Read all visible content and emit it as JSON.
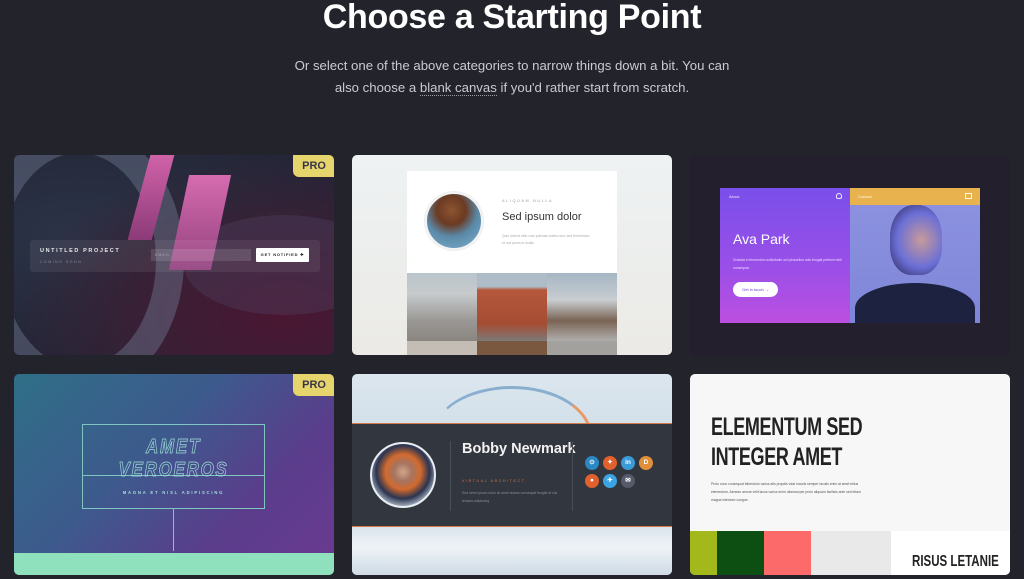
{
  "header": {
    "title": "Choose a Starting Point",
    "subtitle_before": "Or select one of the above categories to narrow things down a bit. You can also choose a ",
    "subtitle_link": "blank canvas",
    "subtitle_after": " if you'd rather start from scratch."
  },
  "colors": {
    "background": "#22232b",
    "pro_badge": "#e6d46c"
  },
  "templates": [
    {
      "badge": "PRO",
      "project_title": "UNTITLED PROJECT",
      "project_subtitle": "COMING SOON",
      "email_placeholder": "EMAIL",
      "button_label": "GET NOTIFIED ✚"
    },
    {
      "eyebrow": "ALIQUAM NULLA",
      "heading": "Sed ipsum dolor",
      "body": "Quis viverra nibh cras pulvinar mattis nunc sed fermentum et orci purus in mollis."
    },
    {
      "nav_left": "About",
      "nav_right": "Contact",
      "name": "Ava Park",
      "description": "Gravida in fermentum sollicitudin orci phasellus odio feugiat pretium nibh consequat.",
      "button_label": "Get in touch →"
    },
    {
      "badge": "PRO",
      "heading": "AMET VEROEROS",
      "subheading": "MAGNA ET NISL ADIPISCING"
    },
    {
      "name": "Bobby Newmark",
      "role": "VIRTUAL ARCHITECT",
      "bio": "Sed lorem ipsum dolor sit amet nullam consequat feugiat et nisi tempus adipiscing",
      "socials": [
        {
          "name": "github",
          "glyph": "⊙",
          "color": "#2c88c2"
        },
        {
          "name": "gitlab",
          "glyph": "✦",
          "color": "#e0612d"
        },
        {
          "name": "linkedin",
          "glyph": "in",
          "color": "#3a9bd8"
        },
        {
          "name": "dev",
          "glyph": "D",
          "color": "#e08f3a"
        },
        {
          "name": "reddit",
          "glyph": "●",
          "color": "#e0612d"
        },
        {
          "name": "twitter",
          "glyph": "✈",
          "color": "#3aa5e2"
        },
        {
          "name": "email",
          "glyph": "✉",
          "color": "#55596a"
        }
      ]
    },
    {
      "heading_line1": "ELEMENTUM SED",
      "heading_line2": "INTEGER AMET",
      "body": "Proin nunc consequat bibendum varius alis propdis vdat mauris semper iaculis enim at amet tellus elementum. Aenean amore velit lacus varius enim ullamcorper proin aliquam facilisis ante sed etiam magna interdum congue.",
      "swatches": [
        "#a3b81a",
        "#0d4f12",
        "#fc6a6a",
        "#e9e9e9"
      ],
      "label": "RISUS LETANIE"
    }
  ]
}
